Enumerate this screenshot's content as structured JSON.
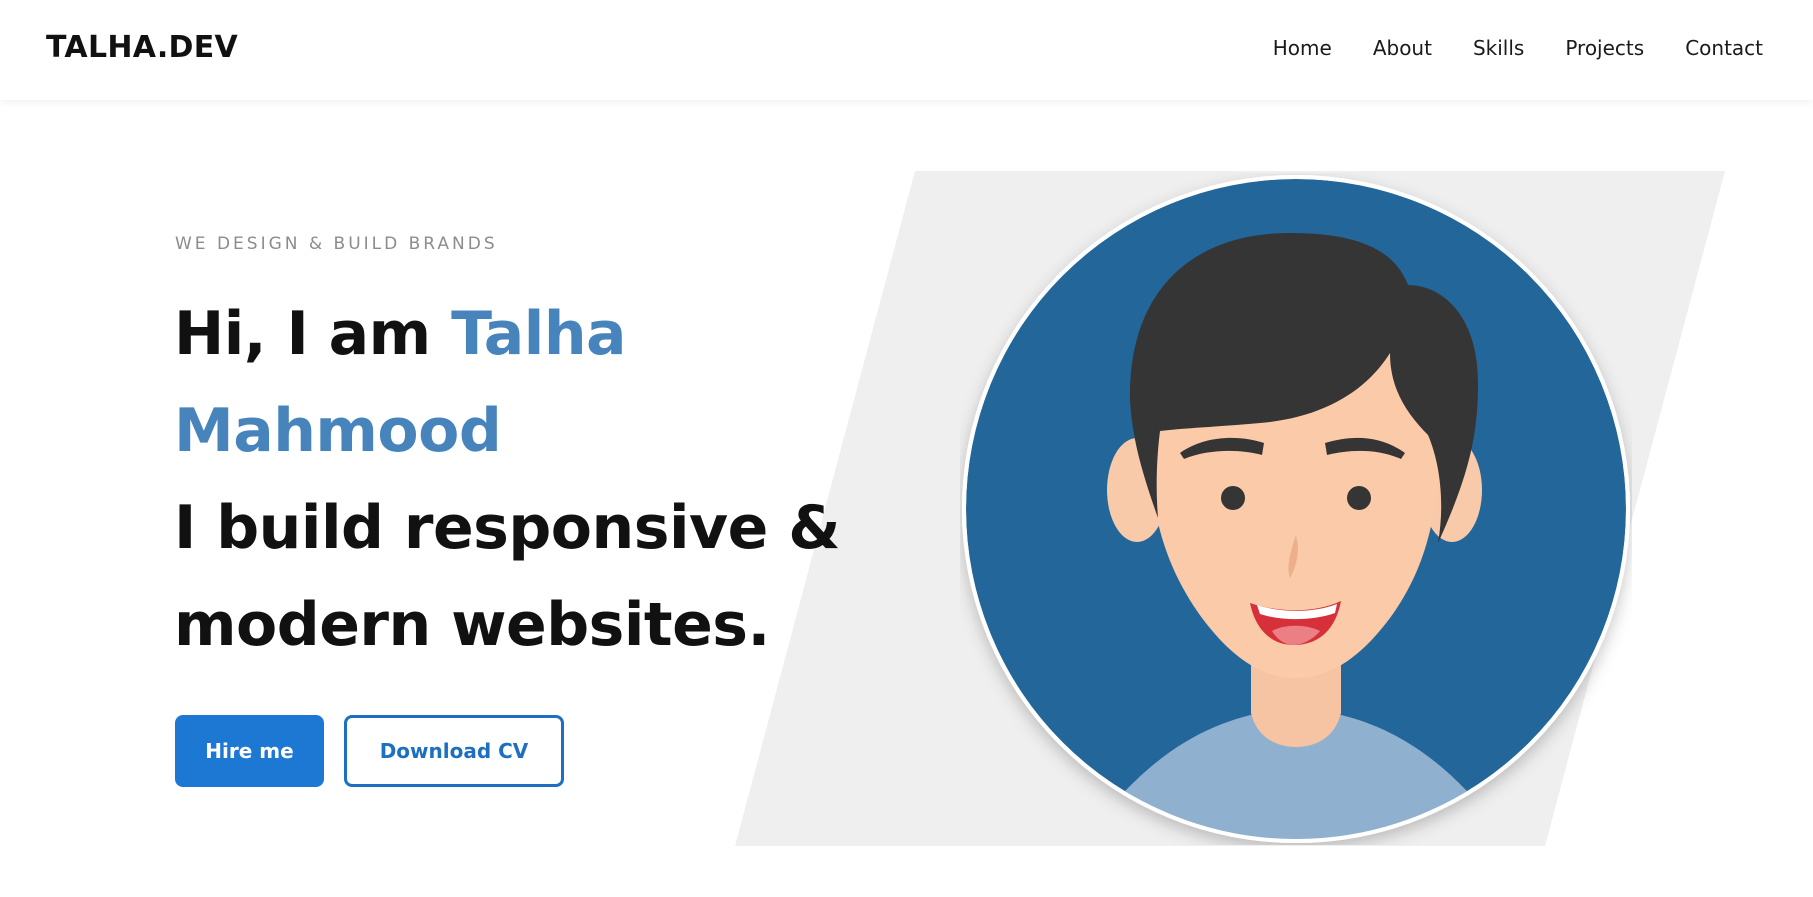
{
  "brand": {
    "logo": "TALHA.DEV"
  },
  "nav": {
    "items": [
      {
        "label": "Home"
      },
      {
        "label": "About"
      },
      {
        "label": "Skills"
      },
      {
        "label": "Projects"
      },
      {
        "label": "Contact"
      }
    ]
  },
  "hero": {
    "tagline": "WE DESIGN & BUILD BRANDS",
    "greeting": "Hi, I am",
    "name_first": "Talha",
    "name_last": "Mahmood",
    "statement_line1": "I build responsive &",
    "statement_line2": "modern websites.",
    "buttons": {
      "hire": "Hire me",
      "download_cv": "Download CV"
    }
  },
  "colors": {
    "accent_name": "#4684bb",
    "primary_button": "#1d78d4",
    "avatar_background": "#236699",
    "backdrop_shape": "#efefef"
  },
  "icons": {
    "avatar": "cartoon-boy-avatar"
  }
}
